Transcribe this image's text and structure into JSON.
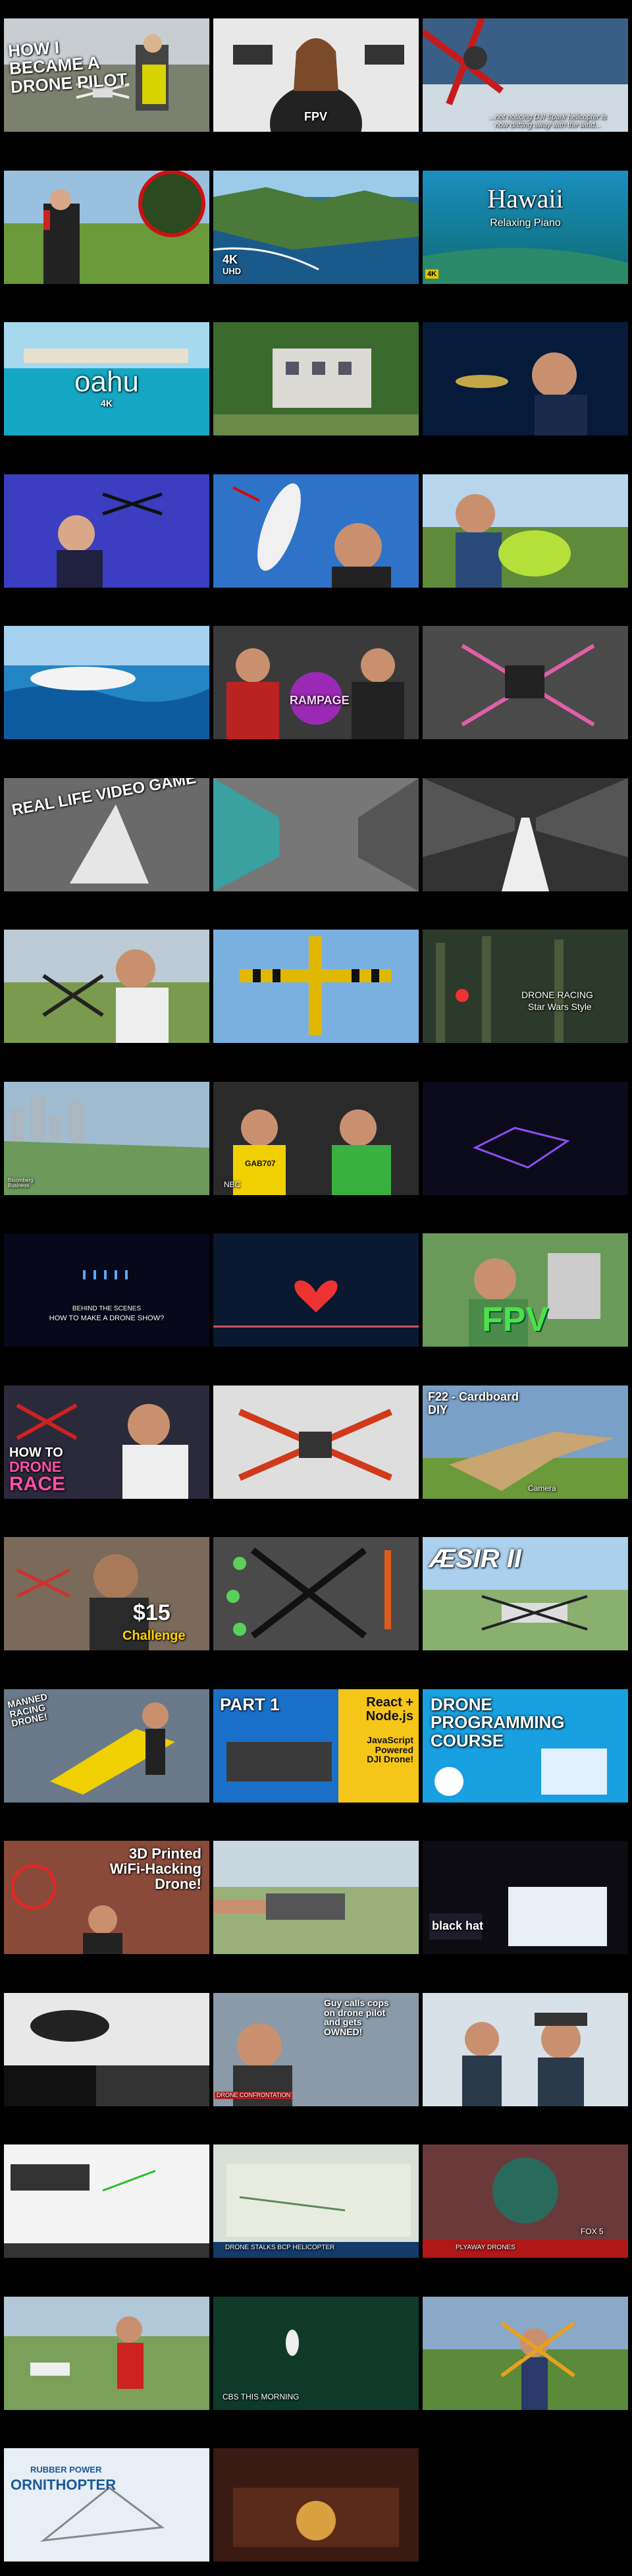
{
  "page": {
    "background": "#000000"
  },
  "captions": {
    "t1": "HOW I\nBECAME A\nDRONE PILOT",
    "t2": "FPV",
    "t3": "...not noticing DJI Spark helicopter is\nnow drifting away with the wind...",
    "t5a": "4K",
    "t5b": "UHD",
    "t6a": "Hawaii",
    "t6b": "Relaxing Piano",
    "t6c": "4K",
    "t7a": "oahu",
    "t7b": "4K",
    "t13": "RAMPAGE",
    "t16": "REAL LIFE VIDEO GAME",
    "t21a": "DRONE RACING",
    "t21b": "Star Wars Style",
    "t22": "Bloomberg\nBusiness",
    "t23a": "GAB707",
    "t23b": "NBC",
    "t25a": "BEHIND THE SCENES",
    "t25b": "HOW TO MAKE A DRONE SHOW?",
    "t27": "FPV",
    "t28a": "HOW TO",
    "t28b": "DRONE",
    "t28c": "RACE",
    "t30a": "F22 - Cardboard",
    "t30b": "DIY",
    "t30c": "Camera",
    "t31a": "$15",
    "t31b": "Challenge",
    "t33": "ÆSIR II",
    "t34": "MANNED\nRACING\nDRONE!",
    "t35a": "PART 1",
    "t35b": "React +\nNode.js",
    "t35c": "JavaScript\nPowered\nDJI Drone!",
    "t36a": "DRONE\nPROGRAMMING\nCOURSE",
    "t37": "3D Printed\nWiFi-Hacking\nDrone!",
    "t39a": "black hat",
    "t41a": "Guy calls cops\non drone pilot\nand gets\nOWNED!",
    "t41b": "DRONE CONFRONTATION",
    "t44": "DRONE STALKS BCP HELICOPTER",
    "t45a": "FOX 5",
    "t45b": "PLYAWAY DRONES",
    "t47": "CBS THIS MORNING",
    "t49a": "RUBBER POWER",
    "t49b": "ORNITHOPTER"
  }
}
